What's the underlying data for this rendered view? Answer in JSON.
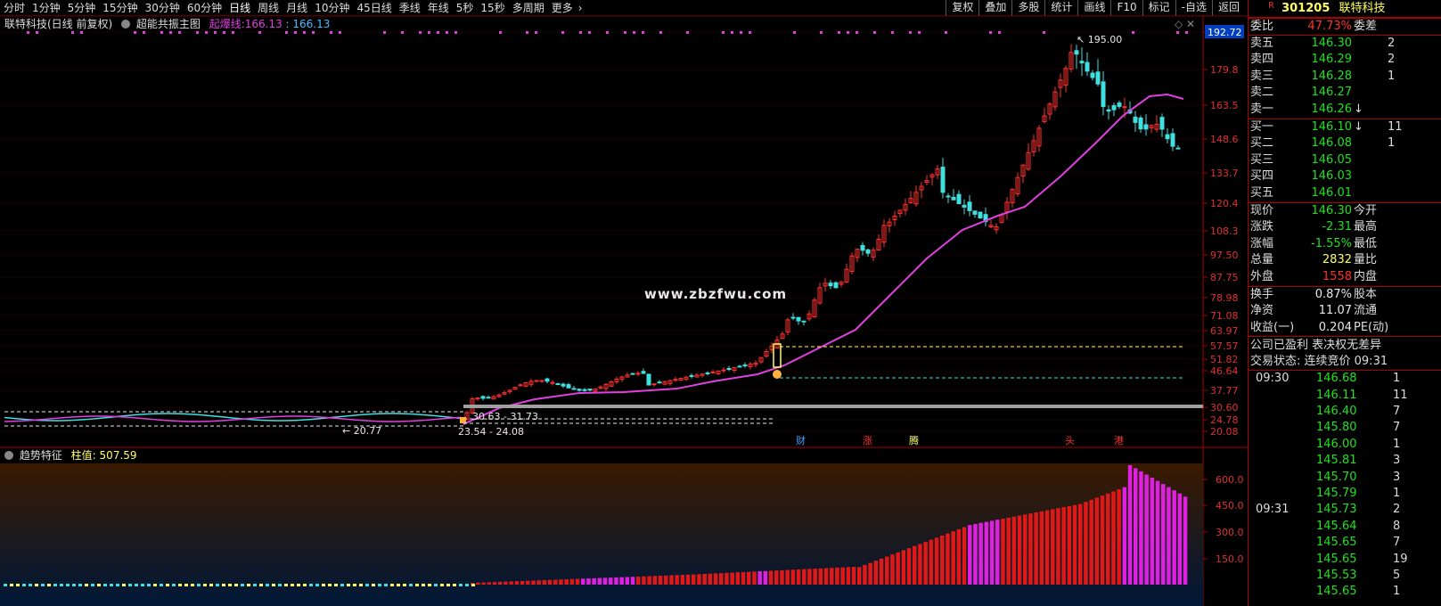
{
  "toolbar": {
    "periods": [
      "分时",
      "1分钟",
      "5分钟",
      "15分钟",
      "30分钟",
      "60分钟",
      "日线",
      "周线",
      "月线",
      "10分钟",
      "45日线",
      "季线",
      "年线",
      "5秒",
      "15秒",
      "多周期",
      "更多"
    ],
    "active_period": "日线",
    "right_buttons": [
      "复权",
      "叠加",
      "多股",
      "统计",
      "画线",
      "F10",
      "标记",
      "-自选",
      "返回"
    ]
  },
  "main_header": {
    "stock_mode": "联特科技(日线 前复权)",
    "indicator": "超能共振主图",
    "line_label": "起爆线:",
    "line_value": "166.13",
    "line_value2": "166.13",
    "window_controls": "◇ ✕"
  },
  "watermark": "www.zbzfwu.com",
  "price_axis": {
    "ticks": [
      "192.72",
      "179.8",
      "163.5",
      "148.6",
      "133.7",
      "120.4",
      "108.3",
      "97.50",
      "87.75",
      "78.98",
      "71.08",
      "63.97",
      "57.57",
      "51.82",
      "46.64",
      "37.77",
      "30.60",
      "24.78",
      "20.08"
    ],
    "current_marker": "192.72",
    "high_label": "195.00",
    "low_label": "20.77",
    "range_label1": "30.63 - 31.73",
    "range_label2": "23.54 - 24.08"
  },
  "event_markers": [
    "财",
    "涨",
    "腾",
    "头",
    "港"
  ],
  "sub_header": {
    "name": "趋势特征",
    "label": "柱值:",
    "value": "507.59"
  },
  "sub_axis": {
    "ticks": [
      "600.0",
      "450.0",
      "300.0",
      "150.0"
    ]
  },
  "colors": {
    "up": "#ff3030",
    "down": "#40e0e0",
    "ma": "#e040e0",
    "accent": "#ffff60",
    "panel_border": "#aa0000"
  },
  "panel": {
    "flag": "R",
    "code": "301205",
    "name": "联特科技",
    "weibi_label": "委比",
    "weibi_value": "47.73%",
    "weicha_label": "委差",
    "asks": [
      {
        "label": "卖五",
        "price": "146.30",
        "vol": "2"
      },
      {
        "label": "卖四",
        "price": "146.29",
        "vol": "2"
      },
      {
        "label": "卖三",
        "price": "146.28",
        "vol": "1"
      },
      {
        "label": "卖二",
        "price": "146.27",
        "vol": ""
      },
      {
        "label": "卖一",
        "price": "146.26",
        "vol": "",
        "arrow": "↓"
      }
    ],
    "bids": [
      {
        "label": "买一",
        "price": "146.10",
        "vol": "11",
        "arrow": "↓"
      },
      {
        "label": "买二",
        "price": "146.08",
        "vol": "1"
      },
      {
        "label": "买三",
        "price": "146.05",
        "vol": ""
      },
      {
        "label": "买四",
        "price": "146.03",
        "vol": ""
      },
      {
        "label": "买五",
        "price": "146.01",
        "vol": ""
      }
    ],
    "quote": [
      {
        "k": "现价",
        "v": "146.30",
        "cls": "green",
        "x": "今开"
      },
      {
        "k": "涨跌",
        "v": "-2.31",
        "cls": "green",
        "x": "最高"
      },
      {
        "k": "涨幅",
        "v": "-1.55%",
        "cls": "green",
        "x": "最低"
      },
      {
        "k": "总量",
        "v": "2832",
        "cls": "yellow",
        "x": "量比"
      },
      {
        "k": "外盘",
        "v": "1558",
        "cls": "red",
        "x": "内盘"
      }
    ],
    "quote2": [
      {
        "k": "换手",
        "v": "0.87%",
        "cls": "white",
        "x": "股本"
      },
      {
        "k": "净资",
        "v": "11.07",
        "cls": "white",
        "x": "流通"
      },
      {
        "k": "收益(一)",
        "v": "0.204",
        "cls": "white",
        "x": "PE(动)"
      }
    ],
    "info1": "公司已盈利 表决权无差异",
    "info2": "交易状态: 连续竞价 09:31",
    "ticks": [
      {
        "t": "09:30",
        "p": "146.68",
        "cls": "green",
        "v": "1"
      },
      {
        "t": "",
        "p": "146.11",
        "cls": "green",
        "v": "11"
      },
      {
        "t": "",
        "p": "146.40",
        "cls": "green",
        "v": "7"
      },
      {
        "t": "",
        "p": "145.80",
        "cls": "green",
        "v": "7"
      },
      {
        "t": "",
        "p": "146.00",
        "cls": "green",
        "v": "1"
      },
      {
        "t": "",
        "p": "145.81",
        "cls": "green",
        "v": "3"
      },
      {
        "t": "",
        "p": "145.70",
        "cls": "green",
        "v": "3"
      },
      {
        "t": "",
        "p": "145.79",
        "cls": "green",
        "v": "1"
      },
      {
        "t": "09:31",
        "p": "145.73",
        "cls": "green",
        "v": "2"
      },
      {
        "t": "",
        "p": "145.64",
        "cls": "green",
        "v": "8"
      },
      {
        "t": "",
        "p": "145.65",
        "cls": "green",
        "v": "7"
      },
      {
        "t": "",
        "p": "145.65",
        "cls": "green",
        "v": "19"
      },
      {
        "t": "",
        "p": "145.53",
        "cls": "green",
        "v": "5"
      },
      {
        "t": "",
        "p": "145.65",
        "cls": "green",
        "v": "1"
      }
    ]
  }
}
